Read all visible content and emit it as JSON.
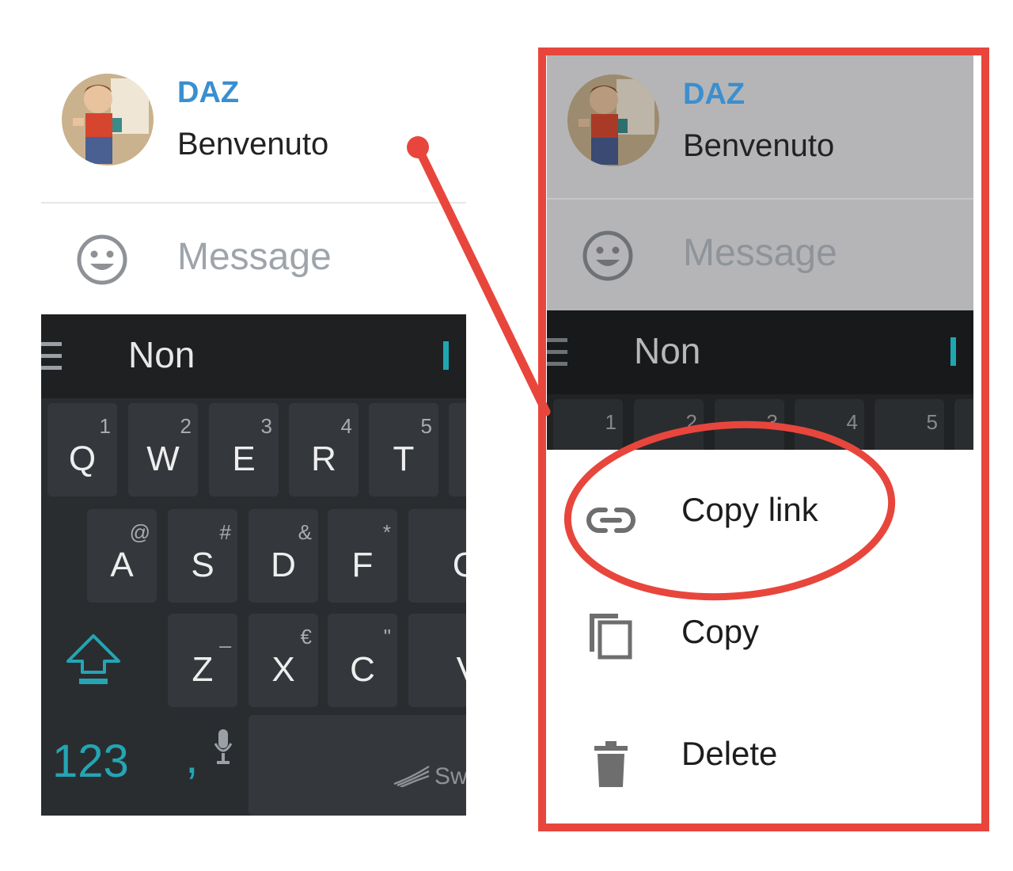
{
  "chat": {
    "contact_name": "DAZ",
    "message_text": "Benvenuto",
    "input_placeholder": "Message"
  },
  "keyboard": {
    "suggestion": "Non",
    "row1": [
      {
        "key": "Q",
        "alt": "1"
      },
      {
        "key": "W",
        "alt": "2"
      },
      {
        "key": "E",
        "alt": "3"
      },
      {
        "key": "R",
        "alt": "4"
      },
      {
        "key": "T",
        "alt": "5"
      }
    ],
    "row2": [
      {
        "key": "A",
        "alt": "@"
      },
      {
        "key": "S",
        "alt": "#"
      },
      {
        "key": "D",
        "alt": "&"
      },
      {
        "key": "F",
        "alt": "*"
      },
      {
        "key": "G",
        "alt": ""
      }
    ],
    "row3": [
      {
        "key": "Z",
        "alt": "_"
      },
      {
        "key": "X",
        "alt": "€"
      },
      {
        "key": "C",
        "alt": "\""
      },
      {
        "key": "V",
        "alt": ""
      }
    ],
    "numbers_label": "123",
    "comma": ",",
    "brand": "Swift"
  },
  "context_menu": {
    "items": [
      {
        "label": "Copy link",
        "icon": "link-icon"
      },
      {
        "label": "Copy",
        "icon": "copy-icon"
      },
      {
        "label": "Delete",
        "icon": "trash-icon"
      }
    ]
  },
  "colors": {
    "name_blue": "#3a8fd0",
    "keyboard_accent": "#24a5b4",
    "annotation_red": "#e8463c"
  }
}
